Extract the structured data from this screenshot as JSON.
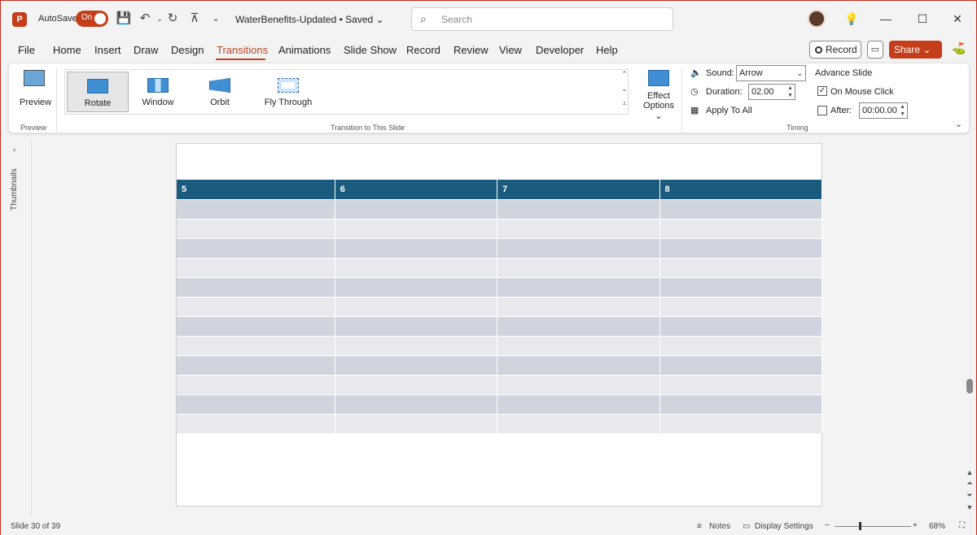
{
  "titlebar": {
    "autosave_label": "AutoSave",
    "autosave_state": "On",
    "doc_title": "WaterBenefits-Updated • Saved ⌄",
    "search_placeholder": "Search"
  },
  "menu": {
    "items": [
      "File",
      "Home",
      "Insert",
      "Draw",
      "Design",
      "Transitions",
      "Animations",
      "Slide Show",
      "Record",
      "Review",
      "View",
      "Developer",
      "Help"
    ],
    "active": "Transitions",
    "record_label": "Record",
    "share_label": "Share"
  },
  "ribbon": {
    "preview_label": "Preview",
    "preview_group": "Preview",
    "gallery_items": [
      "Rotate",
      "Window",
      "Orbit",
      "Fly Through"
    ],
    "selected_transition": "Rotate",
    "effect_options_line1": "Effect",
    "effect_options_line2": "Options ⌄",
    "transition_group": "Transition to This Slide",
    "sound_label": "Sound:",
    "sound_value": "Arrow",
    "duration_label": "Duration:",
    "duration_value": "02.00",
    "apply_all_label": "Apply To All",
    "advance_title": "Advance Slide",
    "on_mouse_click_label": "On Mouse Click",
    "on_mouse_click_checked": true,
    "after_label": "After:",
    "after_value": "00:00.00",
    "timing_group": "Timing"
  },
  "thumbnails": {
    "label": "Thumbnails"
  },
  "slide": {
    "table_headers": [
      "5",
      "6",
      "7",
      "8"
    ],
    "body_rows": 12
  },
  "statusbar": {
    "slide_counter": "Slide 30 of 39",
    "notes_label": "Notes",
    "display_settings_label": "Display Settings",
    "zoom_level": "68%"
  },
  "colors": {
    "accent": "#c43e1c",
    "table_header": "#1b5c7e",
    "row_band_dark": "#cfd4de",
    "row_band_light": "#e8e9ed"
  }
}
